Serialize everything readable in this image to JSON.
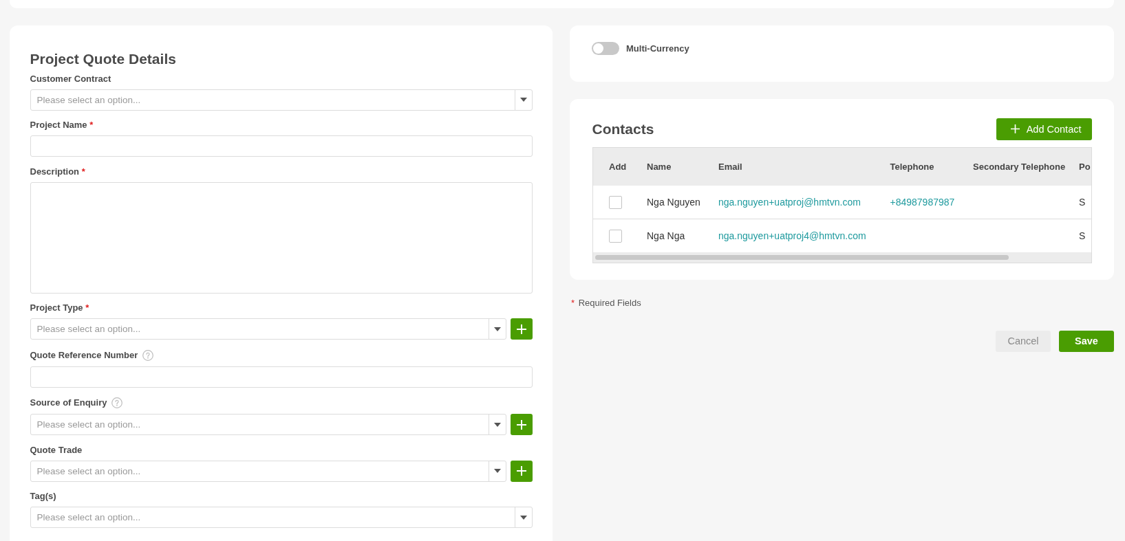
{
  "form": {
    "title": "Project Quote Details",
    "fields": [
      {
        "label": "Customer Contract",
        "kind": "select",
        "placeholder": "Please select an option..."
      },
      {
        "label": "Project Name",
        "required_mark": "*",
        "kind": "text"
      },
      {
        "label": "Description",
        "required_mark": "*",
        "kind": "textarea"
      },
      {
        "label": "Project Type",
        "required_mark": "*",
        "kind": "select",
        "placeholder": "Please select an option...",
        "add_button": true
      },
      {
        "label": "Quote Reference Number",
        "help": true,
        "kind": "text"
      },
      {
        "label": "Source of Enquiry",
        "help": true,
        "kind": "select",
        "placeholder": "Please select an option...",
        "add_button": true
      },
      {
        "label": "Quote Trade",
        "kind": "select",
        "placeholder": "Please select an option...",
        "add_button": true
      },
      {
        "label": "Tag(s)",
        "kind": "select",
        "placeholder": "Please select an option..."
      }
    ]
  },
  "currency": {
    "label": "Multi-Currency",
    "on": false
  },
  "contacts": {
    "title": "Contacts",
    "add_button": "Add Contact",
    "table": {
      "columns": [
        "Add",
        "Name",
        "Email",
        "Telephone",
        "Secondary Telephone",
        "Po"
      ],
      "rows": [
        {
          "checked": false,
          "name": "Nga Nguyen",
          "email": "nga.nguyen+uatproj@hmtvn.com",
          "telephone": "+84987987987",
          "column_6": "S"
        },
        {
          "checked": false,
          "name": "Nga Nga",
          "email": "nga.nguyen+uatproj4@hmtvn.com",
          "column_6": "S"
        }
      ]
    }
  },
  "required_note": {
    "mark": "*",
    "text": "Required Fields"
  },
  "buttons": [
    {
      "label": "Cancel",
      "kind": "secondary"
    },
    {
      "label": "Save",
      "kind": "primary"
    }
  ]
}
